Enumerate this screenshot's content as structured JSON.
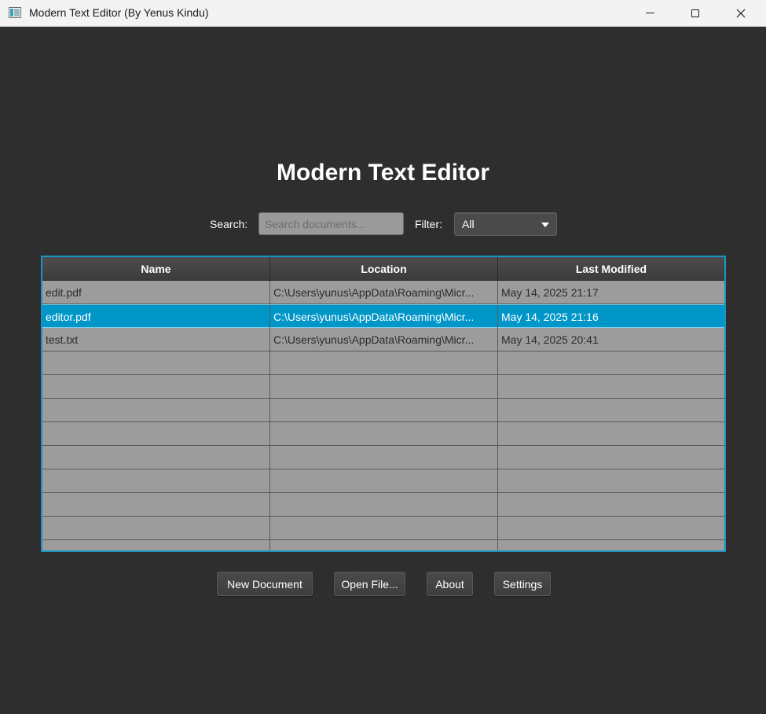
{
  "window": {
    "title": "Modern Text Editor (By Yenus Kindu)",
    "icon": "app-window-icon",
    "controls": [
      "minimize-icon",
      "maximize-icon",
      "close-icon"
    ]
  },
  "main": {
    "heading": "Modern Text Editor",
    "search": {
      "label": "Search:",
      "value": "",
      "placeholder": "Search documents..."
    },
    "filter": {
      "label": "Filter:",
      "selected": "All"
    }
  },
  "table": {
    "columns": [
      "Name",
      "Location",
      "Last Modified"
    ],
    "rows": [
      {
        "name": "edit.pdf",
        "location": "C:\\Users\\yunus\\AppData\\Roaming\\Micr...",
        "modified": "May 14, 2025 21:17"
      },
      {
        "name": "editor.pdf",
        "location": "C:\\Users\\yunus\\AppData\\Roaming\\Micr...",
        "modified": "May 14, 2025 21:16"
      },
      {
        "name": "test.txt",
        "location": "C:\\Users\\yunus\\AppData\\Roaming\\Micr...",
        "modified": "May 14, 2025 20:41"
      }
    ],
    "selected_index": 1
  },
  "actions": {
    "new_document": "New Document",
    "open_file": "Open File...",
    "about": "About",
    "settings": "Settings"
  },
  "colors": {
    "background": "#2e2e2e",
    "accent": "#0096c8",
    "table_border": "#1a94c4",
    "row": "#9c9c9c"
  }
}
